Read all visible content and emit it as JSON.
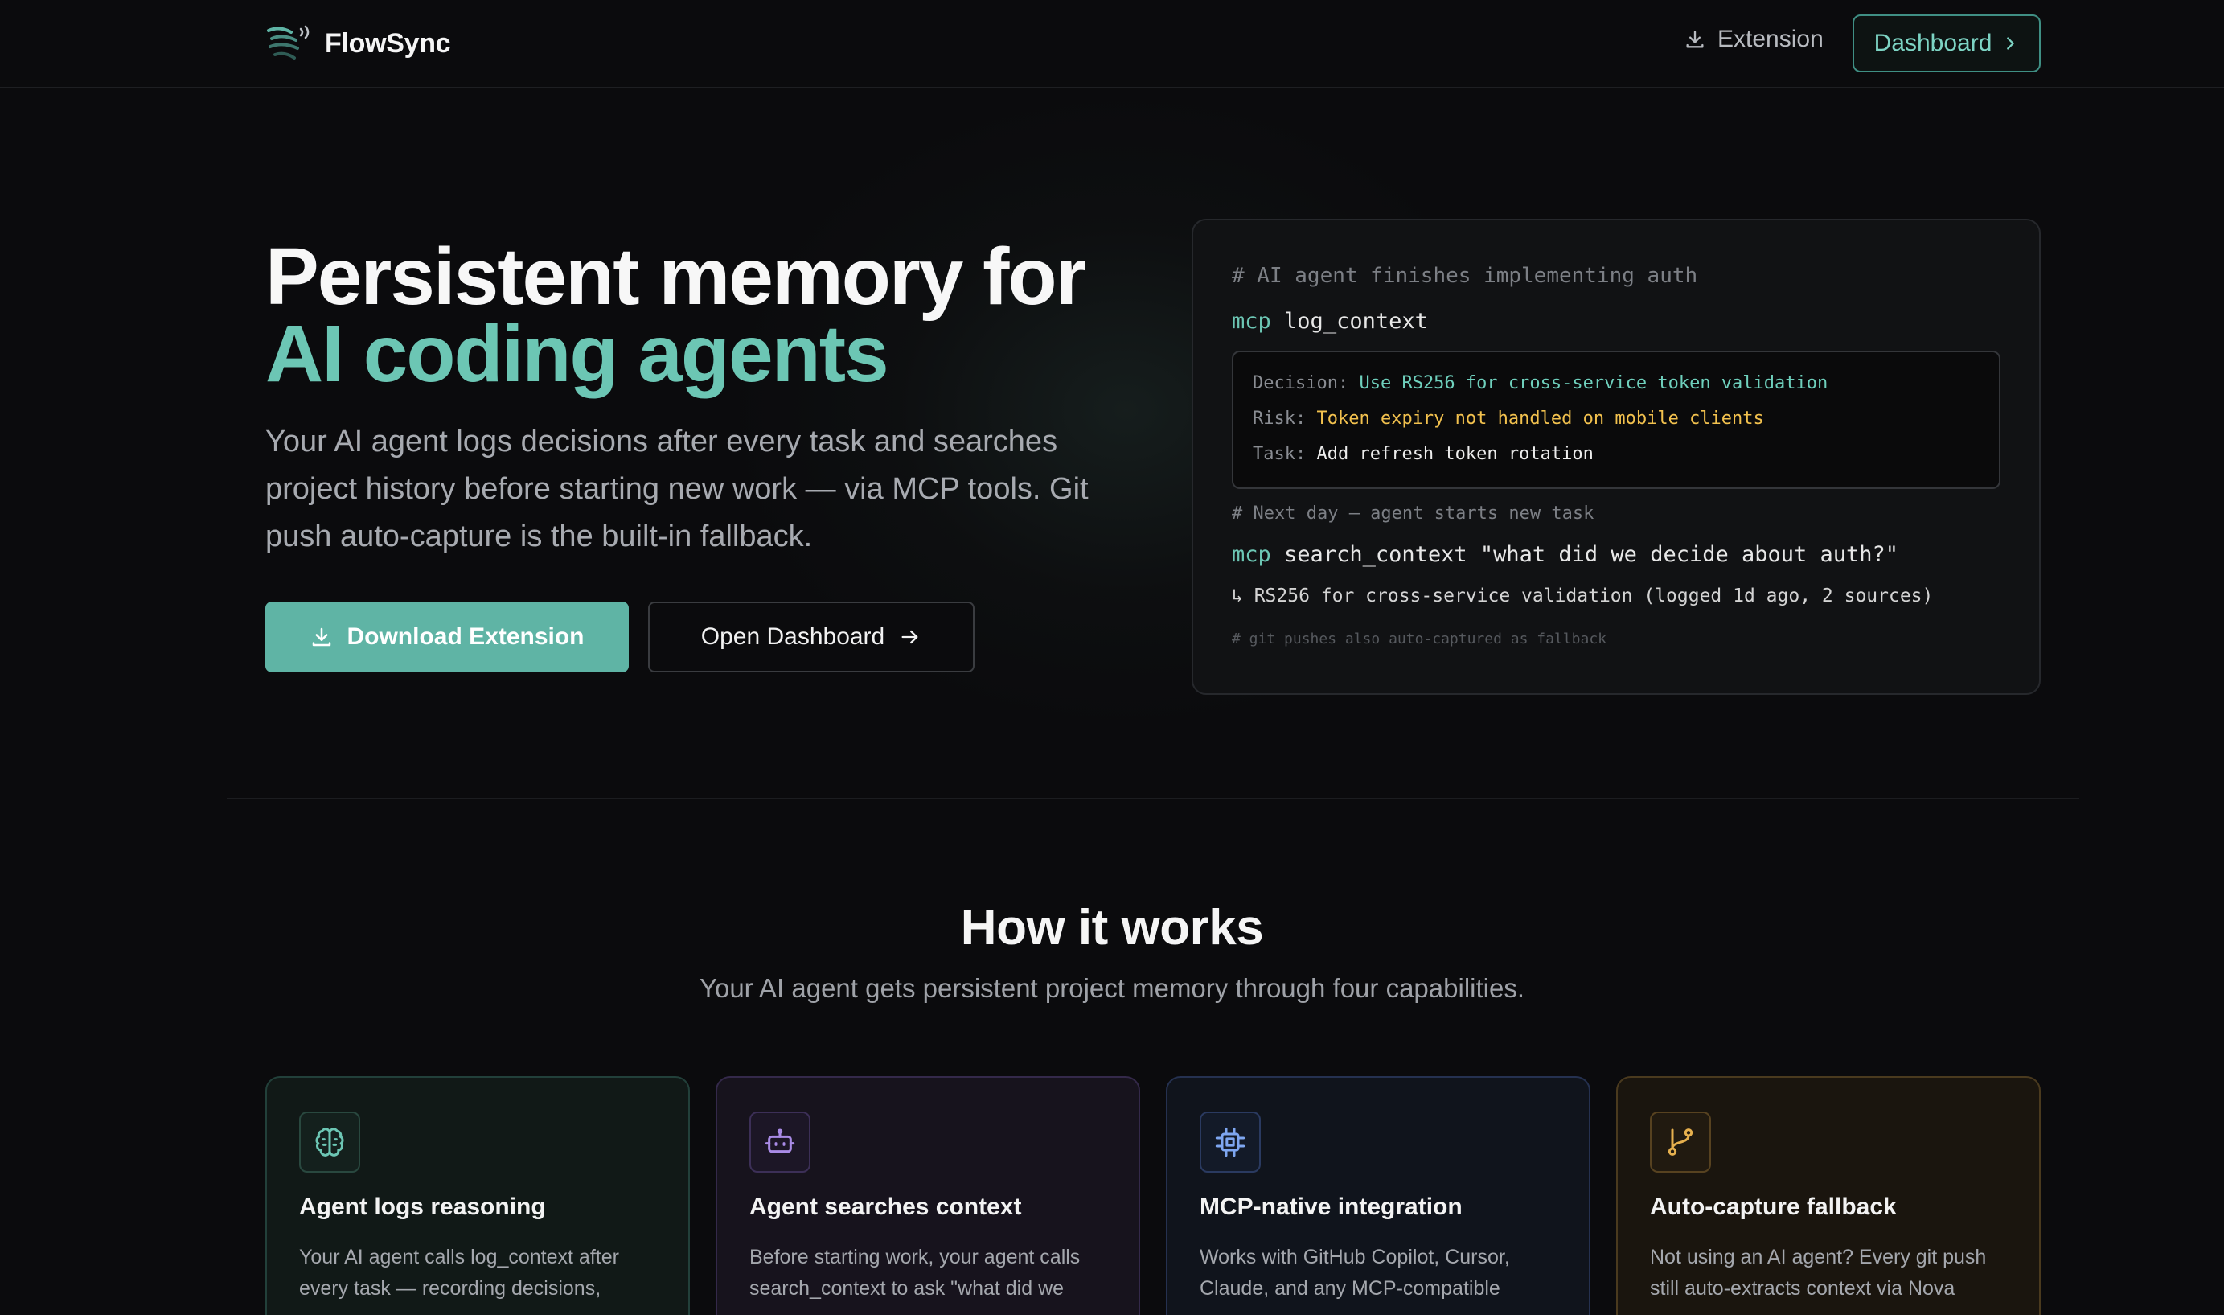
{
  "nav": {
    "brand": "FlowSync",
    "extension_label": "Extension",
    "dashboard_label": "Dashboard"
  },
  "hero": {
    "title_line1": "Persistent memory for",
    "title_line2": "AI coding agents",
    "subtitle": "Your AI agent logs decisions after every task and searches project history before starting new work — via MCP tools. Git push auto-capture is the built-in fallback.",
    "primary_button": "Download Extension",
    "secondary_button": "Open Dashboard"
  },
  "terminal": {
    "comment1": "# AI agent finishes implementing auth",
    "cmd1_keyword": "mcp",
    "cmd1_text": "log_context",
    "decision_label": "Decision:",
    "decision_value": "Use RS256 for cross-service token validation",
    "risk_label": "Risk:",
    "risk_value": "Token expiry not handled on mobile clients",
    "task_label": "Task:",
    "task_value": "Add refresh token rotation",
    "comment2": "# Next day — agent starts new task",
    "cmd2_keyword": "mcp",
    "cmd2_text": "search_context \"what did we decide about auth?\"",
    "result": "↳ RS256 for cross-service validation (logged 1d ago, 2 sources)",
    "comment3": "# git pushes also auto-captured as fallback"
  },
  "how": {
    "title": "How it works",
    "subtitle": "Your AI agent gets persistent project memory through four capabilities.",
    "cards": [
      {
        "icon": "brain-icon",
        "title": "Agent logs reasoning",
        "text": "Your AI agent calls log_context after every task — recording decisions,",
        "accent": "#6cc6b4"
      },
      {
        "icon": "bot-icon",
        "title": "Agent searches context",
        "text": "Before starting work, your agent calls search_context to ask \"what did we",
        "accent": "#a98be6"
      },
      {
        "icon": "chip-icon",
        "title": "MCP-native integration",
        "text": "Works with GitHub Copilot, Cursor, Claude, and any MCP-compatible",
        "accent": "#7ea6f0"
      },
      {
        "icon": "git-branch-icon",
        "title": "Auto-capture fallback",
        "text": "Not using an AI agent? Every git push still auto-extracts context via Nova",
        "accent": "#e6b04e"
      }
    ]
  }
}
